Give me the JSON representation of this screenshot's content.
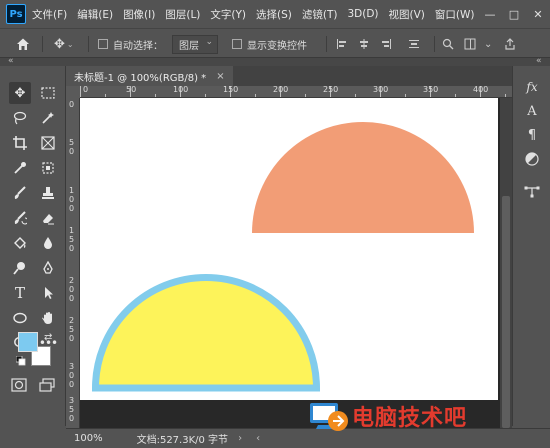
{
  "app": {
    "logo": "Ps"
  },
  "menu": [
    "文件(F)",
    "编辑(E)",
    "图像(I)",
    "图层(L)",
    "文字(Y)",
    "选择(S)",
    "滤镜(T)",
    "3D(D)",
    "视图(V)",
    "窗口(W)"
  ],
  "window_controls": {
    "minimize": "—",
    "maximize": "□",
    "close": "✕"
  },
  "options": {
    "auto_select_label": "自动选择：",
    "layer_dropdown": "图层",
    "show_transform_label": "显示变换控件"
  },
  "document": {
    "tab_title": "未标题-1 @ 100%(RGB/8) *",
    "close_glyph": "×"
  },
  "ruler_top_labels": [
    "0",
    "50",
    "100",
    "150",
    "200",
    "250",
    "300",
    "350",
    "400"
  ],
  "ruler_left_labels": [
    "0",
    "5",
    "0",
    "1",
    "0",
    "0",
    "1",
    "5",
    "0",
    "2",
    "0",
    "0",
    "2",
    "5",
    "0",
    "3",
    "0",
    "0",
    "3",
    "5",
    "0"
  ],
  "colors": {
    "foreground": "#7dcaf0",
    "background": "#ffffff",
    "salmon_shape": "#f29d76",
    "yellow_shape": "#fdf35a",
    "yellow_stroke": "#82ccec"
  },
  "status": {
    "zoom": "100%",
    "doc_info": "文档:527.3K/0 字节",
    "arrow": "›"
  },
  "watermark": {
    "text": "电脑技术吧"
  }
}
